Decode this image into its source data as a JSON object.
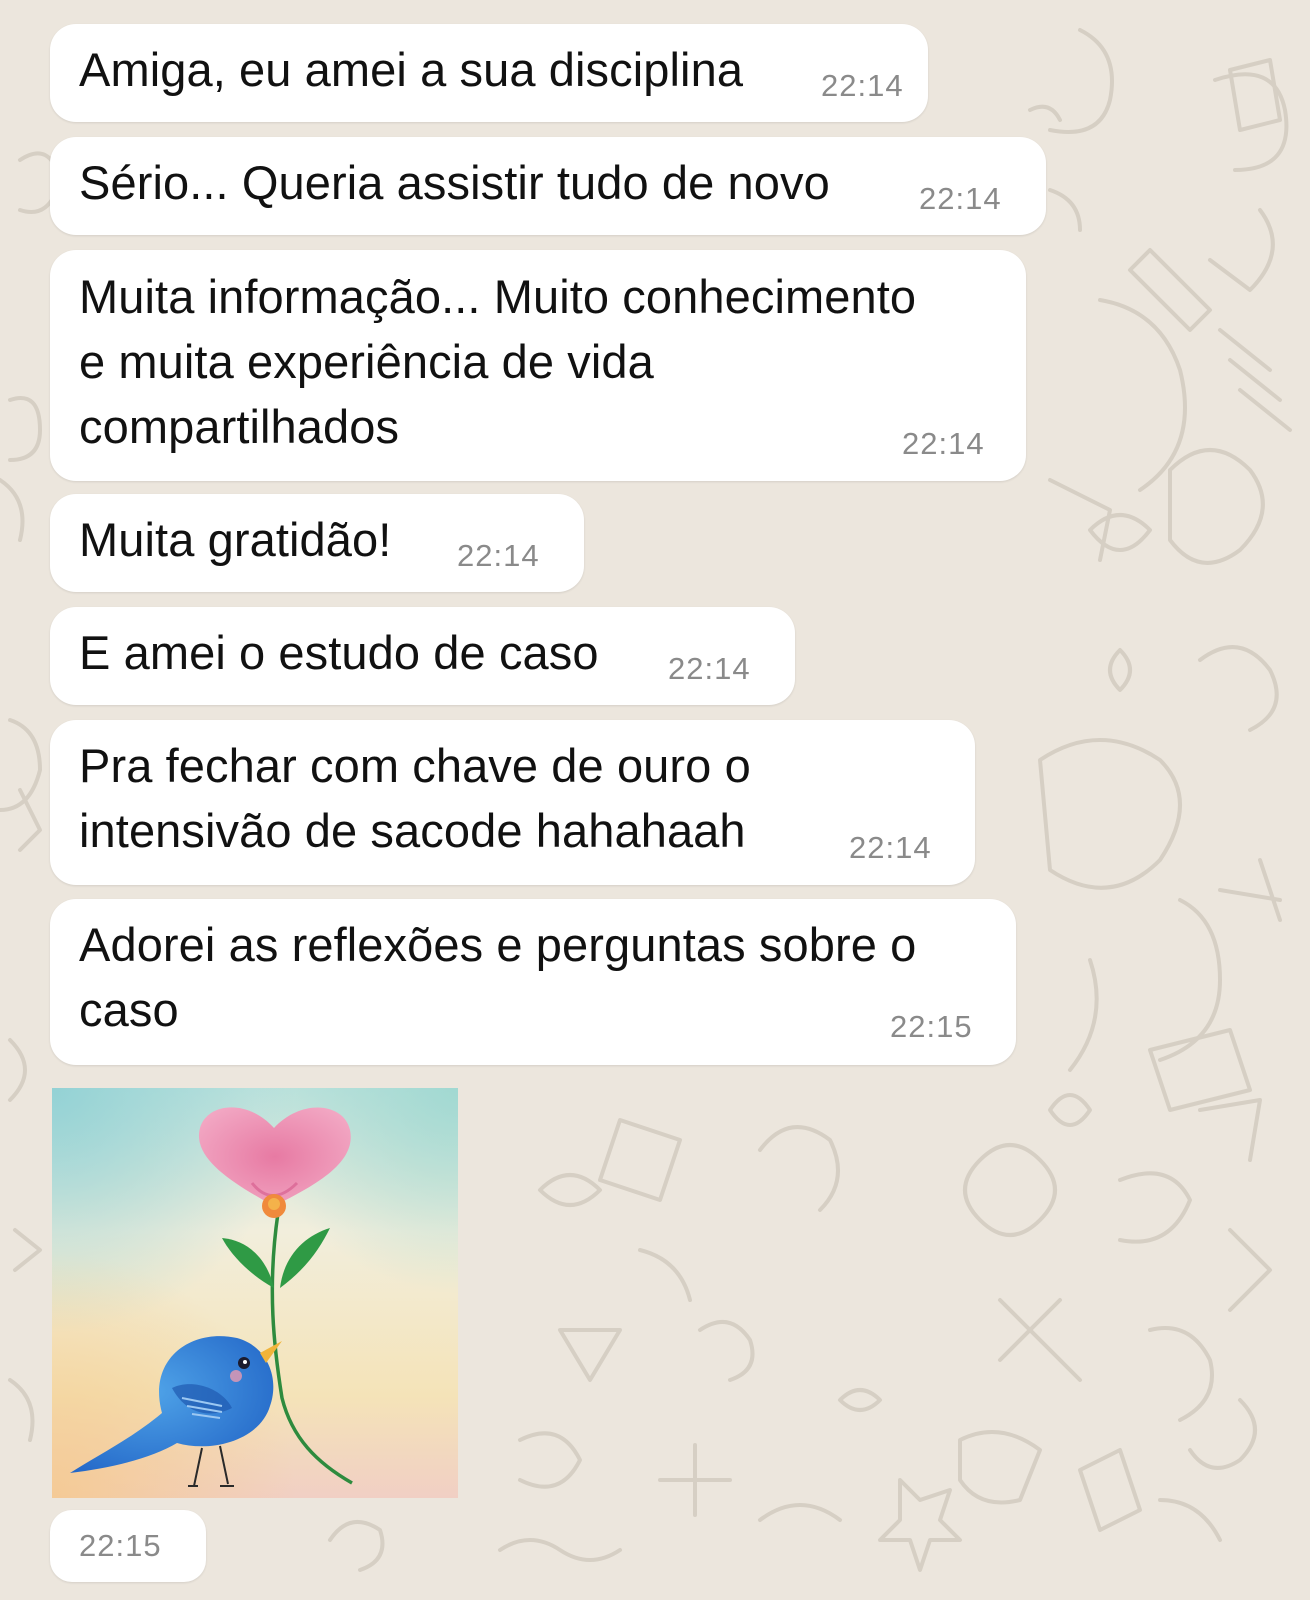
{
  "colors": {
    "wallpaper": "#ECE6DD",
    "doodle": "#D6CFC4",
    "bubble": "#FFFFFF",
    "text": "#111111",
    "time": "#8A8A8A"
  },
  "messages": [
    {
      "text": "Amiga, eu amei a sua disciplina",
      "time": "22:14"
    },
    {
      "text": "Sério... Queria assistir tudo de novo",
      "time": "22:14"
    },
    {
      "text": "Muita informação... Muito conhecimento\ne muita experiência de vida\ncompartilhados",
      "time": "22:14"
    },
    {
      "text": "Muita gratidão!",
      "time": "22:14"
    },
    {
      "text": "E amei o estudo de caso",
      "time": "22:14"
    },
    {
      "text": "Pra fechar com chave de ouro o\nintensivão de sacode hahahaah",
      "time": "22:14"
    },
    {
      "text": "Adorei as reflexões e perguntas sobre o\ncaso",
      "time": "22:15"
    }
  ],
  "image_message": {
    "icon": "bird-with-heart-flower-illustration",
    "time": "22:15"
  }
}
